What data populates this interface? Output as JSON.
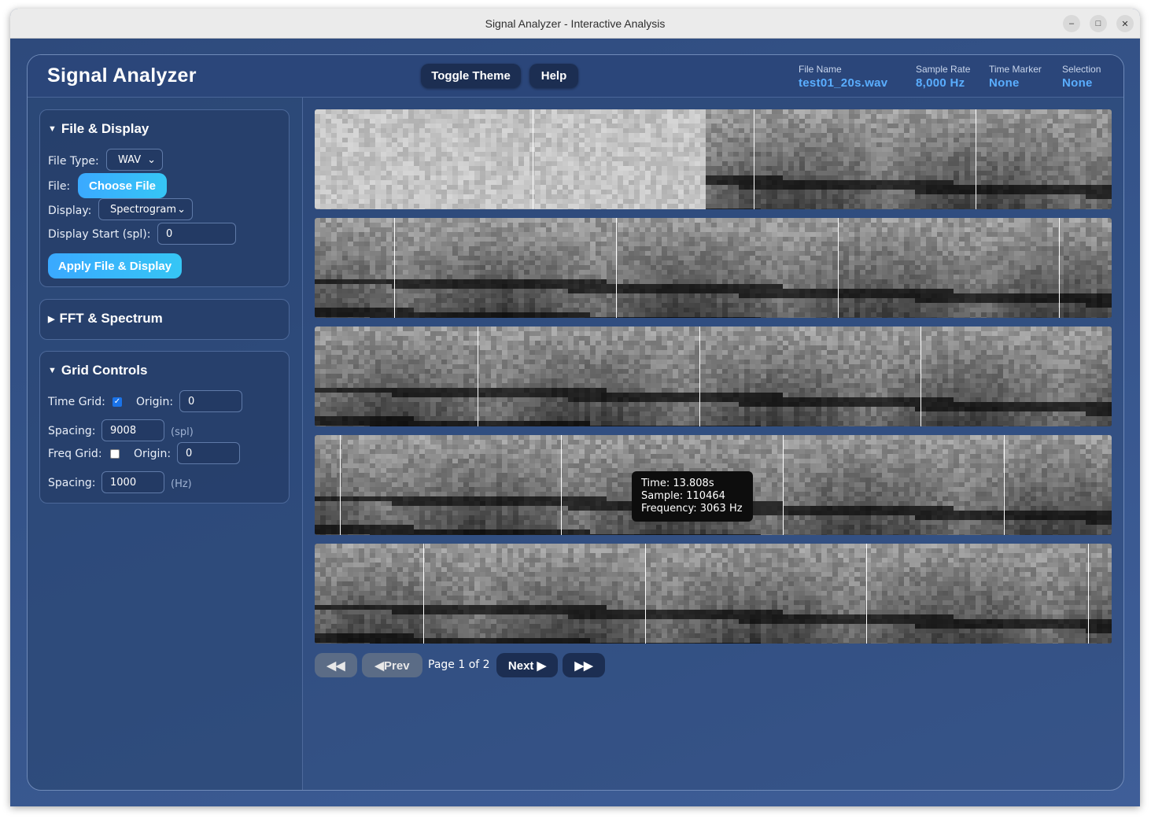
{
  "window": {
    "title": "Signal Analyzer - Interactive Analysis",
    "minimize_icon": "minimize-icon",
    "maximize_icon": "maximize-icon",
    "close_icon": "close-icon"
  },
  "header": {
    "app_title": "Signal Analyzer",
    "toggle_theme_label": "Toggle Theme",
    "help_label": "Help",
    "stats": {
      "file_name_label": "File Name",
      "file_name_value": "test01_20s.wav",
      "sample_rate_label": "Sample Rate",
      "sample_rate_value": "8,000 Hz",
      "time_marker_label": "Time Marker",
      "time_marker_value": "None",
      "selection_label": "Selection",
      "selection_value": "None"
    }
  },
  "sidebar": {
    "file_display": {
      "title": "File & Display",
      "expanded": true,
      "file_type_label": "File Type:",
      "file_type_value": "WAV",
      "file_label": "File:",
      "choose_file_label": "Choose File",
      "display_label": "Display:",
      "display_value": "Spectrogram",
      "display_start_label": "Display Start (spl):",
      "display_start_value": "0",
      "apply_label": "Apply File & Display"
    },
    "fft_spectrum": {
      "title": "FFT & Spectrum",
      "expanded": false
    },
    "grid_controls": {
      "title": "Grid Controls",
      "expanded": true,
      "time_grid_label": "Time Grid:",
      "time_grid_checked": true,
      "time_origin_label": "Origin:",
      "time_origin_value": "0",
      "time_spacing_label": "Spacing:",
      "time_spacing_value": "9008",
      "time_spacing_unit": "(spl)",
      "freq_grid_label": "Freq Grid:",
      "freq_grid_checked": false,
      "freq_origin_label": "Origin:",
      "freq_origin_value": "0",
      "freq_spacing_label": "Spacing:",
      "freq_spacing_value": "1000",
      "freq_spacing_unit": "(Hz)"
    }
  },
  "spectrogram": {
    "display": "Spectrogram",
    "rows": 5,
    "colors": {
      "background": "#1a1a1a",
      "marker": "#ffffff",
      "noise": "#c8c8c8"
    }
  },
  "tooltip": {
    "time": "Time: 13.808s",
    "sample": "Sample: 110464",
    "frequency": "Frequency: 3063 Hz"
  },
  "pager": {
    "first_label": "◀◀",
    "prev_label": "◀Prev",
    "page_info": "Page 1 of 2",
    "next_label": "Next ▶",
    "last_label": "▶▶"
  },
  "colors": {
    "accent": "#3aa9ff",
    "stat_value": "#5aaeff",
    "header_bg": "#2b467a",
    "button_dark": "#1c2e52"
  }
}
